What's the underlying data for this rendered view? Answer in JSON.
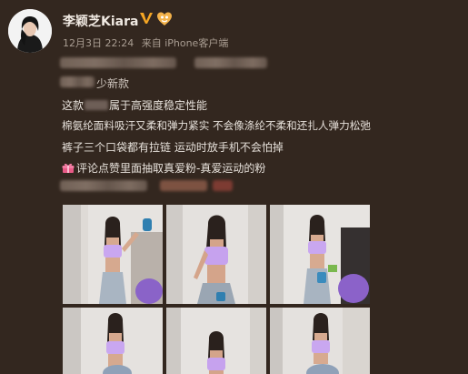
{
  "header": {
    "username": "李颖芝Kiara",
    "timestamp": "12月3日 22:24",
    "source": "来自 iPhone客户端"
  },
  "body": {
    "line1_suffix": "少新款",
    "line2_prefix": "这款",
    "line2_suffix": "属于高强度稳定性能",
    "line3": "棉氨纶面料吸汗又柔和弹力紧实 不会像涤纶不柔和还扎人弹力松弛",
    "line4": "裤子三个口袋都有拉链 运动时放手机不会怕掉",
    "line5": "评论点赞里面抽取真爱粉-真爱运动的粉"
  },
  "icons": {
    "verified": "verified-v-icon",
    "vip": "vip-fan-icon",
    "gift": "gift-emoji-icon"
  },
  "colors": {
    "background": "#33271f",
    "verified": "#f5a623"
  }
}
